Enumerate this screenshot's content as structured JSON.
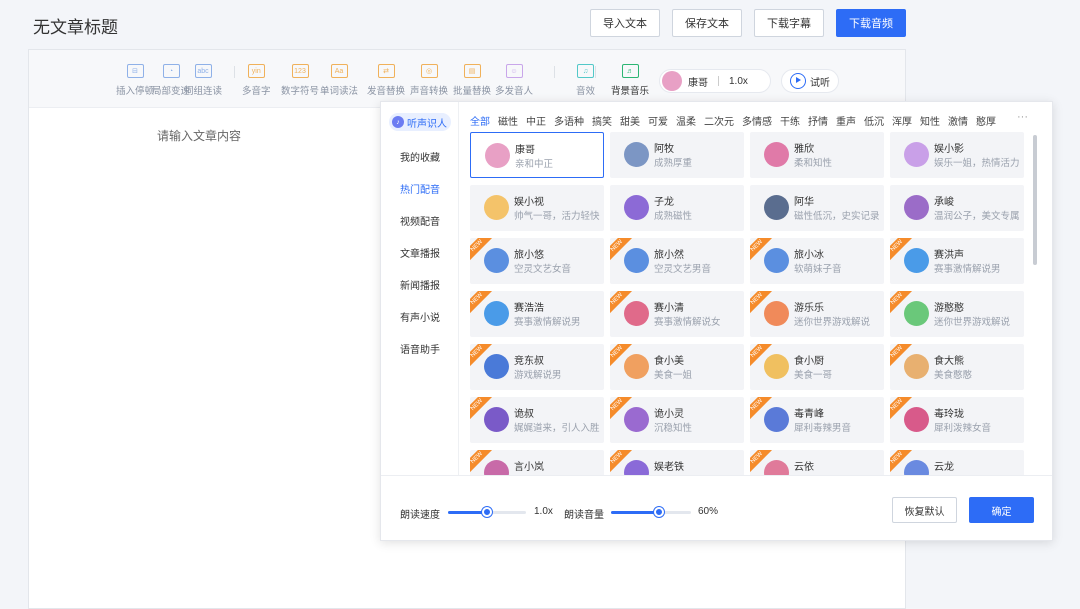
{
  "page_title": "无文章标题",
  "top_buttons": {
    "import": "导入文本",
    "save": "保存文本",
    "download_sub": "下载字幕",
    "download_audio": "下载音频"
  },
  "toolbar": {
    "tools": [
      {
        "label": "插入停顿",
        "icon": "pause-insert-icon",
        "glyph": "⊟",
        "color": "#8fb1e8"
      },
      {
        "label": "局部变速",
        "icon": "speed-gauge-icon",
        "glyph": "◔",
        "color": "#8fb1e8"
      },
      {
        "label": "词组连读",
        "icon": "abc-icon",
        "glyph": "abc",
        "color": "#8fb1e8"
      },
      {
        "label": "多音字",
        "icon": "pinyin-icon",
        "glyph": "yin",
        "color": "#f0b15a"
      },
      {
        "label": "数字符号",
        "icon": "number-icon",
        "glyph": "123",
        "color": "#f0b15a"
      },
      {
        "label": "单词读法",
        "icon": "word-icon",
        "glyph": "Aa",
        "color": "#f0b15a"
      },
      {
        "label": "发音替换",
        "icon": "pronounce-icon",
        "glyph": "⇄",
        "color": "#f0b15a"
      },
      {
        "label": "声音转换",
        "icon": "voice-convert-icon",
        "glyph": "◎",
        "color": "#f0b15a"
      },
      {
        "label": "批量替换",
        "icon": "batch-replace-icon",
        "glyph": "▤",
        "color": "#f0b15a"
      },
      {
        "label": "多发音人",
        "icon": "multi-speaker-icon",
        "glyph": "☺",
        "color": "#c9a6ea"
      },
      {
        "label": "音效",
        "icon": "sound-effect-icon",
        "glyph": "♫",
        "color": "#52c8c8"
      },
      {
        "label": "背景音乐",
        "icon": "music-icon",
        "glyph": "♬",
        "color": "#2bb673"
      }
    ],
    "voice_name": "康哥",
    "speed": "1.0x",
    "listen": "试听"
  },
  "editor_placeholder": "请输入文章内容",
  "panel": {
    "badge": "听声识人",
    "menu": [
      "我的收藏",
      "热门配音",
      "视频配音",
      "文章播报",
      "新闻播报",
      "有声小说",
      "语音助手"
    ],
    "active_menu": "热门配音",
    "categories": [
      "全部",
      "磁性",
      "中正",
      "多语种",
      "搞笑",
      "甜美",
      "可爱",
      "温柔",
      "二次元",
      "多情感",
      "干练",
      "抒情",
      "重声",
      "低沉",
      "浑厚",
      "知性",
      "激情",
      "憨厚"
    ],
    "more": "···",
    "voices": [
      {
        "name": "康哥",
        "desc": "亲和中正",
        "new": false,
        "color": "#e8a0c5"
      },
      {
        "name": "阿牧",
        "desc": "成熟厚重",
        "new": false,
        "color": "#7c96c4"
      },
      {
        "name": "雅欣",
        "desc": "柔和知性",
        "new": false,
        "color": "#e07aa8"
      },
      {
        "name": "娱小影",
        "desc": "娱乐一姐，热情活力",
        "new": false,
        "color": "#c9a0e8"
      },
      {
        "name": "娱小视",
        "desc": "帅气一哥，活力轻快",
        "new": false,
        "color": "#f4c36a"
      },
      {
        "name": "子龙",
        "desc": "成熟磁性",
        "new": false,
        "color": "#8c6ad6"
      },
      {
        "name": "阿华",
        "desc": "磁性低沉，史实记录",
        "new": false,
        "color": "#5a6d8f"
      },
      {
        "name": "承峻",
        "desc": "温润公子，美文专属",
        "new": false,
        "color": "#9b6cc8"
      },
      {
        "name": "旅小悠",
        "desc": "空灵文艺女音",
        "new": true,
        "color": "#5b8fe0"
      },
      {
        "name": "旅小然",
        "desc": "空灵文艺男音",
        "new": true,
        "color": "#5b8fe0"
      },
      {
        "name": "旅小冰",
        "desc": "软萌妹子音",
        "new": true,
        "color": "#5b8fe0"
      },
      {
        "name": "赛洪声",
        "desc": "赛事激情解说男",
        "new": true,
        "color": "#4a9be8"
      },
      {
        "name": "赛浩浩",
        "desc": "赛事激情解说男",
        "new": true,
        "color": "#4a9be8"
      },
      {
        "name": "赛小清",
        "desc": "赛事激情解说女",
        "new": true,
        "color": "#e06a8a"
      },
      {
        "name": "游乐乐",
        "desc": "迷你世界游戏解说",
        "new": true,
        "color": "#f08a5a"
      },
      {
        "name": "游憨憨",
        "desc": "迷你世界游戏解说",
        "new": true,
        "color": "#6ac87a"
      },
      {
        "name": "竞东叔",
        "desc": "游戏解说男",
        "new": true,
        "color": "#4a7ad8"
      },
      {
        "name": "食小美",
        "desc": "美食一姐",
        "new": true,
        "color": "#f0a060"
      },
      {
        "name": "食小厨",
        "desc": "美食一哥",
        "new": true,
        "color": "#f0c060"
      },
      {
        "name": "食大熊",
        "desc": "美食憨憨",
        "new": true,
        "color": "#e8b070"
      },
      {
        "name": "诡叔",
        "desc": "娓娓道来，引人入胜",
        "new": true,
        "color": "#7a5ac8"
      },
      {
        "name": "诡小灵",
        "desc": "沉稳知性",
        "new": true,
        "color": "#9a6ad0"
      },
      {
        "name": "毒青峰",
        "desc": "犀利毒辣男音",
        "new": true,
        "color": "#5a7ad8"
      },
      {
        "name": "毒玲珑",
        "desc": "犀利泼辣女音",
        "new": true,
        "color": "#d85a8a"
      },
      {
        "name": "言小岚",
        "desc": "",
        "new": true,
        "color": "#c86aa8"
      },
      {
        "name": "娱老铁",
        "desc": "",
        "new": true,
        "color": "#8a6ad8"
      },
      {
        "name": "云依",
        "desc": "",
        "new": true,
        "color": "#e07a9a"
      },
      {
        "name": "云龙",
        "desc": "",
        "new": true,
        "color": "#6a8ae0"
      }
    ],
    "speed_label": "朗读速度",
    "speed_value": "1.0x",
    "speed_fraction": 0.5,
    "volume_label": "朗读音量",
    "volume_value": "60%",
    "volume_fraction": 0.6,
    "reset": "恢复默认",
    "confirm": "确定"
  }
}
